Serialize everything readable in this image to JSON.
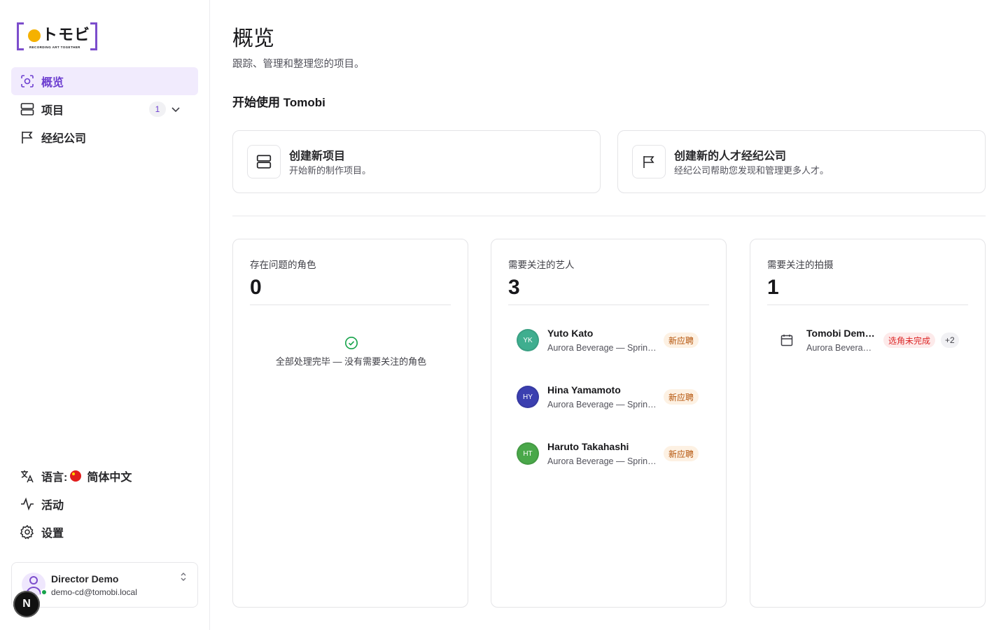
{
  "brand": {
    "logo_text": "トモビ",
    "tagline": "RECORDING ART TOGETHER",
    "accent": "#7c4dcc",
    "dot_color": "#f5b100"
  },
  "sidebar": {
    "items": [
      {
        "label": "概览",
        "icon": "overview-icon",
        "active": true
      },
      {
        "label": "项目",
        "icon": "projects-icon",
        "count": "1"
      },
      {
        "label": "经纪公司",
        "icon": "flag-icon"
      }
    ],
    "bottom": {
      "language_prefix": "语言:",
      "language_value": "简体中文",
      "activity": "活动",
      "settings": "设置"
    },
    "user": {
      "name": "Director Demo",
      "email": "demo-cd@tomobi.local"
    },
    "n_badge": "N"
  },
  "main": {
    "title": "概览",
    "subtitle": "跟踪、管理和整理您的项目。",
    "getting_started": "开始使用 Tomobi",
    "actions": [
      {
        "title": "创建新项目",
        "desc": "开始新的制作项目。"
      },
      {
        "title": "创建新的人才经纪公司",
        "desc": "经纪公司帮助您发现和管理更多人才。"
      }
    ],
    "stats": [
      {
        "label": "存在问题的角色",
        "value": "0",
        "empty_msg": "全部处理完毕 — 没有需要关注的角色"
      },
      {
        "label": "需要关注的艺人",
        "value": "3",
        "artists": [
          {
            "initials": "YK",
            "name": "Yuto Kato",
            "sub": "Aurora Beverage — Spring Campaign",
            "badge": "新应聘",
            "color": "#3fae8f"
          },
          {
            "initials": "HY",
            "name": "Hina Yamamoto",
            "sub": "Aurora Beverage — Spring Campaign",
            "badge": "新应聘",
            "color": "#3b3fb0"
          },
          {
            "initials": "HT",
            "name": "Haruto Takahashi",
            "sub": "Aurora Beverage — Spring Campaign",
            "badge": "新应聘",
            "color": "#4aa84a"
          }
        ]
      },
      {
        "label": "需要关注的拍摄",
        "value": "1",
        "shoot": {
          "name": "Tomobi Demo Shoot",
          "sub": "Aurora Beverage",
          "badge": "选角未完成",
          "more": "+2"
        }
      }
    ]
  }
}
